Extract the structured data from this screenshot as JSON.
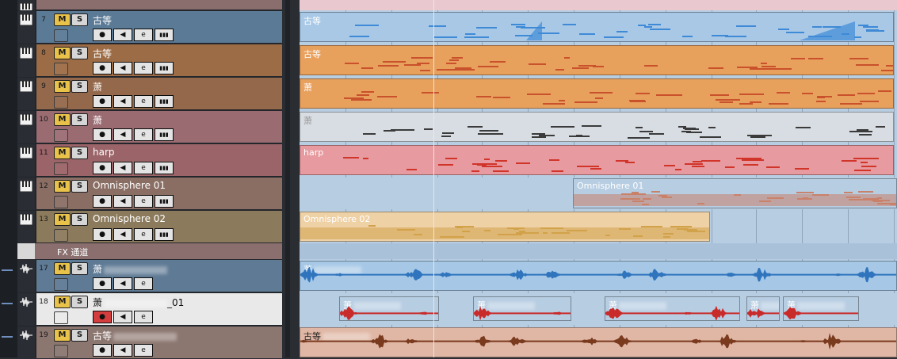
{
  "header_row": {
    "visible": true
  },
  "fx_folder": {
    "label": "FX 通道"
  },
  "tracks": [
    {
      "num": "7",
      "name": "古等",
      "type": "instrument",
      "panel": "#5b7a95",
      "lane": "#a8c8e6",
      "note": "#3f8ad6"
    },
    {
      "num": "8",
      "name": "古等",
      "type": "instrument",
      "panel": "#9c6c46",
      "lane": "#e8a05d",
      "note": "#c9512b"
    },
    {
      "num": "9",
      "name": "萧",
      "type": "instrument",
      "panel": "#94684a",
      "lane": "#e8a05d",
      "note": "#c9512b"
    },
    {
      "num": "10",
      "name": "萧",
      "type": "instrument",
      "panel": "#9a6c72",
      "lane": "#d8dde3",
      "note": "#3b3b3b"
    },
    {
      "num": "11",
      "name": "harp",
      "type": "instrument",
      "panel": "#9a6468",
      "lane": "#e79a9f",
      "note": "#d1352a"
    },
    {
      "num": "12",
      "name": "Omnisphere 01",
      "type": "instrument",
      "panel": "#8a6e64",
      "lane": "#b7cde2",
      "note": "#c9826a"
    },
    {
      "num": "13",
      "name": "Omnisphere 02",
      "type": "instrument",
      "panel": "#8c7a5c",
      "lane": "#efd1a6",
      "note": "#d2a24a"
    },
    {
      "num": "17",
      "name": "萧",
      "type": "audio",
      "panel": "#5e7a94",
      "lane": "#a6c8e6",
      "note": "#2f74bd"
    },
    {
      "num": "18",
      "name": "萧",
      "name_suffix": "_01",
      "type": "audio",
      "panel": "#e9e9e9",
      "lane": "#b7cde2",
      "note": "#c92a2a"
    },
    {
      "num": "19",
      "name": "古等",
      "type": "audio",
      "panel": "#8c7670",
      "lane": "#e0b7a5",
      "note": "#7a3a1e"
    }
  ],
  "parts": {
    "t7": "古等",
    "t8": "古等",
    "t9": "萧",
    "t10": "萧",
    "t11": "harp",
    "t12": "Omnisphere 01",
    "t13": "Omnisphere 02",
    "t17": "萧",
    "t18": "萧",
    "t19": "古等"
  },
  "colors": {
    "mute": "#e9c24a",
    "solo": "#d6d6d6",
    "record": "#d43d3d",
    "cursor": "#e8e8e8"
  },
  "icons": [
    "piano-keys-icon",
    "waveform-icon",
    "folder-icon",
    "record-icon",
    "speaker-icon",
    "edit-e-icon",
    "keyboard-icon"
  ]
}
